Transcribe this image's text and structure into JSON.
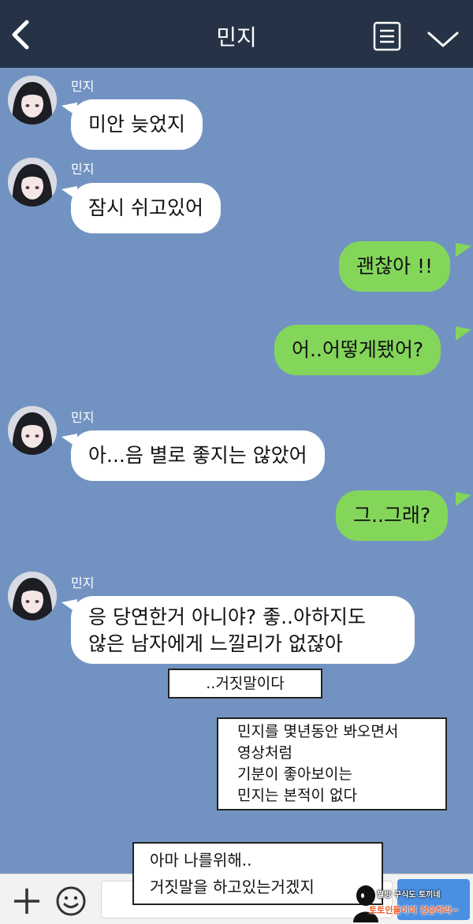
{
  "header": {
    "title": "민지",
    "back_icon": "chevron-left-icon",
    "menu_icon": "list-menu-icon",
    "collapse_icon": "chevron-down-icon",
    "background": "#263346"
  },
  "chat": {
    "background": "#7293c2",
    "incoming_bubble_color": "#ffffff",
    "outgoing_bubble_color": "#84d65a",
    "messages": [
      {
        "from": "민지",
        "text": "미안 늦었지"
      },
      {
        "from": "민지",
        "text": "잠시 쉬고있어"
      },
      {
        "from": "me",
        "text": "괜찮아 !!"
      },
      {
        "from": "me",
        "text": "어..어떻게됐어?"
      },
      {
        "from": "민지",
        "text": "아...음 별로 좋지는 않았어"
      },
      {
        "from": "me",
        "text": "그..그래?"
      },
      {
        "from": "민지",
        "line1": "응 당연한거 아니야? 좋..아하지도",
        "line2": "않은 남자에게 느낄리가 없잖아"
      }
    ]
  },
  "notes": {
    "note1": "..거짓말이다",
    "note2": {
      "line1": "민지를 몇년동안 봐오면서",
      "line2": "영상처럼",
      "line3": "기분이 좋아보이는",
      "line4": "민지는 본적이 없다"
    },
    "note3": {
      "line1": "아마 나를위해..",
      "line2": "거짓말을 하고있는거겠지"
    }
  },
  "bottom_bar": {
    "plus_icon": "plus-icon",
    "emoji_icon": "smiley-icon",
    "send_icon": "send-button"
  },
  "watermark": {
    "line1": "짤방 구식도 토끼네",
    "line2": "토토인들이여 건승하라~"
  }
}
